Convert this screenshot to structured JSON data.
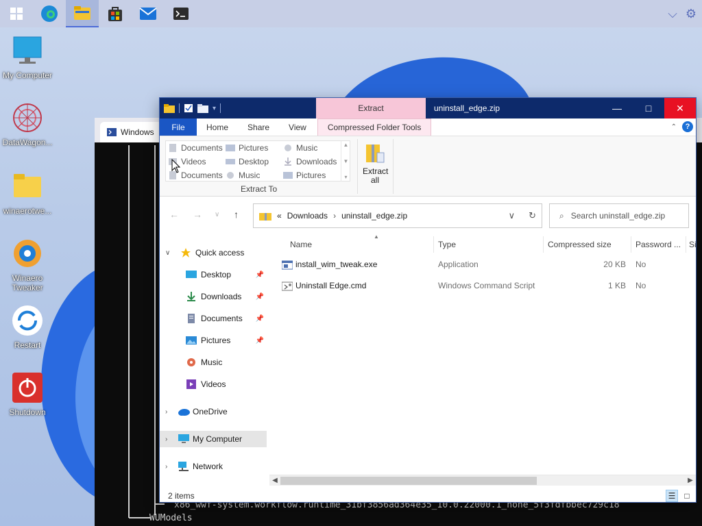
{
  "taskbar": {
    "items": [
      "start",
      "edge",
      "file-explorer",
      "store",
      "mail",
      "terminal"
    ]
  },
  "desktop_icons": [
    {
      "label": "My Computer"
    },
    {
      "label": "DataWagon..."
    },
    {
      "label": "winaerotwe..."
    },
    {
      "label": "Winaero Tweaker"
    },
    {
      "label": "Restart"
    },
    {
      "label": "Shutdown"
    }
  ],
  "terminal": {
    "tab_label": "Windows",
    "line1": "x86_wwf-system.workflow.runtime_31bf3856ad364e35_10.0.22000.1_none_5f3fdfbbec729c18",
    "line2": "WUModels"
  },
  "explorer": {
    "context_tab": "Extract",
    "title": "uninstall_edge.zip",
    "ribbon_tabs": {
      "file": "File",
      "home": "Home",
      "share": "Share",
      "view": "View",
      "compressed": "Compressed Folder Tools"
    },
    "extract_locations": [
      "Documents",
      "Pictures",
      "Music",
      "Videos",
      "Desktop",
      "Downloads",
      "Documents",
      "Music",
      "Pictures"
    ],
    "extract_group_label": "Extract To",
    "extract_all_label": "Extract all",
    "address": {
      "prefix": "«",
      "crumb1": "Downloads",
      "crumb2": "uninstall_edge.zip"
    },
    "search_placeholder": "Search uninstall_edge.zip",
    "nav_pane": {
      "quick_access": "Quick access",
      "desktop": "Desktop",
      "downloads": "Downloads",
      "documents": "Documents",
      "pictures": "Pictures",
      "music": "Music",
      "videos": "Videos",
      "onedrive": "OneDrive",
      "my_computer": "My Computer",
      "network": "Network"
    },
    "columns": {
      "name": "Name",
      "type": "Type",
      "size": "Compressed size",
      "password": "Password ...",
      "extra": "Si"
    },
    "files": [
      {
        "name": "install_wim_tweak.exe",
        "type": "Application",
        "size": "20 KB",
        "password": "No"
      },
      {
        "name": "Uninstall Edge.cmd",
        "type": "Windows Command Script",
        "size": "1 KB",
        "password": "No"
      }
    ],
    "status": "2 items"
  }
}
